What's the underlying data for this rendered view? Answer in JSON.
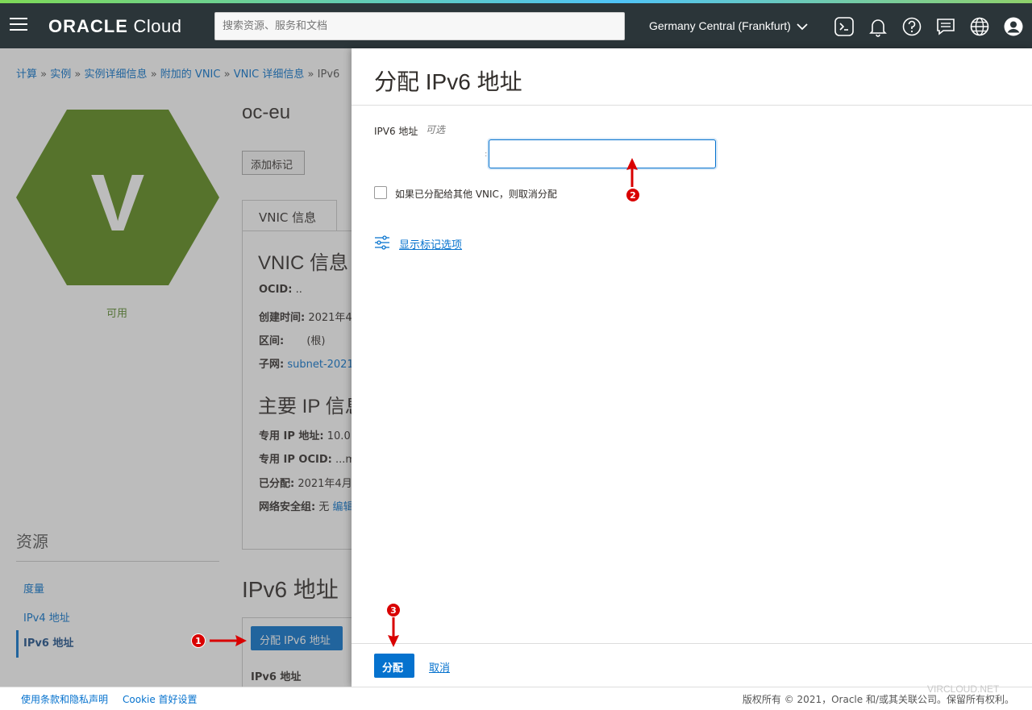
{
  "topbar": {
    "brand_bold": "ORACLE",
    "brand_light": "Cloud",
    "search_placeholder": "搜索资源、服务和文档",
    "region": "Germany Central (Frankfurt)"
  },
  "breadcrumb": {
    "items": [
      "计算",
      "实例",
      "实例详细信息",
      "附加的 VNIC",
      "VNIC 详细信息"
    ],
    "separator": "»",
    "current": "IPv6"
  },
  "instance": {
    "avatar_letter": "V",
    "avatar_color": "#5b8a17",
    "status": "可用",
    "title": "oc-eu",
    "add_tag_label": "添加标记"
  },
  "tabs": {
    "vnic_info": "VNIC 信息"
  },
  "vnic_info": {
    "heading": "VNIC 信息",
    "ocid_label": "OCID:",
    "ocid_value": "..",
    "created_label": "创建时间:",
    "created_value": "2021年4",
    "compartment_label": "区间:",
    "compartment_value": "(根)",
    "subnet_label": "子网:",
    "subnet_value": "subnet-2021"
  },
  "primary_ip": {
    "heading": "主要 IP 信息",
    "private_ip_label": "专用 IP 地址:",
    "private_ip_value": "10.0",
    "private_ocid_label": "专用 IP OCID:",
    "private_ocid_value": "...m",
    "assigned_label": "已分配:",
    "assigned_value": "2021年4月",
    "nsg_label": "网络安全组:",
    "nsg_value": "无",
    "nsg_link": "编辑"
  },
  "resources": {
    "title": "资源",
    "items": [
      "度量",
      "IPv4 地址",
      "IPv6 地址"
    ],
    "active_index": 2
  },
  "ipv6_section": {
    "title": "IPv6 地址",
    "assign_button": "分配 IPv6 地址",
    "column_header": "IPv6 地址"
  },
  "dialog": {
    "title": "分配 IPv6 地址",
    "field_label": "IPV6 地址",
    "field_optional": "可选",
    "field_prefix": ":",
    "field_value": "",
    "checkbox_label": "如果已分配给其他 VNIC，则取消分配",
    "checkbox_checked": false,
    "tag_options_link": "显示标记选项",
    "primary_button": "分配",
    "cancel_link": "取消"
  },
  "footer": {
    "terms_link": "使用条款和隐私声明",
    "cookie_link": "Cookie 首好设置",
    "copyright": "版权所有 © 2021，Oracle 和/或其关联公司。保留所有权利。"
  },
  "watermark": "VIRCLOUD.NET",
  "annotations": {
    "marker_1": "1",
    "marker_2": "2",
    "marker_3": "3"
  },
  "colors": {
    "accent_blue": "#0572ce",
    "topbar": "#2b3539",
    "annotation_red": "#d90000"
  }
}
